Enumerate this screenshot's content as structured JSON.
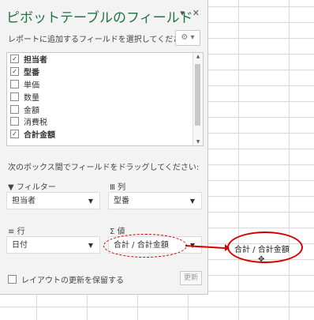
{
  "pane": {
    "title": "ピボットテーブルのフィールド",
    "collapse_icon": "▾",
    "close_icon": "✕",
    "subtitle": "レポートに追加するフィールドを選択してください:",
    "gear_label": "⚙ ▾",
    "fields": [
      {
        "label": "担当者",
        "checked": true
      },
      {
        "label": "型番",
        "checked": true
      },
      {
        "label": "単価",
        "checked": false
      },
      {
        "label": "数量",
        "checked": false
      },
      {
        "label": "金額",
        "checked": false
      },
      {
        "label": "消費税",
        "checked": false
      },
      {
        "label": "合計金額",
        "checked": true
      }
    ],
    "drag_message": "次のボックス間でフィールドをドラッグしてください:",
    "areas": {
      "filter_title": "フィルター",
      "columns_title": "列",
      "rows_title": "行",
      "values_title": "値",
      "filter_value": "担当者",
      "columns_value": "型番",
      "rows_value": "日付",
      "values_value": "合計 / 合計金額"
    },
    "defer_label": "レイアウトの更新を保留する",
    "update_label": "更新"
  },
  "drag_target": {
    "label": "合計 / 合計金額"
  },
  "colors": {
    "title": "#217346",
    "annotation_red": "#d40000"
  }
}
